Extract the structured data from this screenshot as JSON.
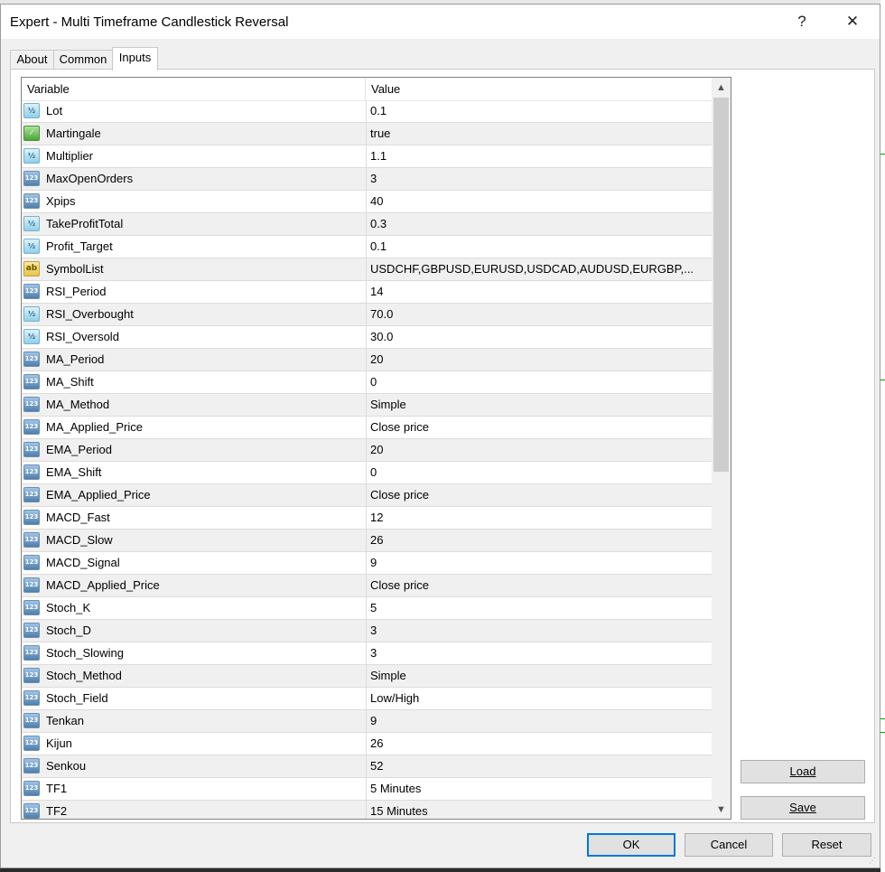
{
  "window": {
    "title": "Expert - Multi Timeframe Candlestick Reversal",
    "help_glyph": "?",
    "close_glyph": "✕"
  },
  "tabs": [
    {
      "label": "About",
      "active": false
    },
    {
      "label": "Common",
      "active": false
    },
    {
      "label": "Inputs",
      "active": true
    }
  ],
  "grid": {
    "header": {
      "variable": "Variable",
      "value": "Value"
    },
    "rows": [
      {
        "icon": "double-icon",
        "name": "Lot",
        "value": "0.1"
      },
      {
        "icon": "bool-icon",
        "name": "Martingale",
        "value": "true"
      },
      {
        "icon": "double-icon",
        "name": "Multiplier",
        "value": "1.1"
      },
      {
        "icon": "int-icon",
        "name": "MaxOpenOrders",
        "value": "3"
      },
      {
        "icon": "int-icon",
        "name": "Xpips",
        "value": "40"
      },
      {
        "icon": "double-icon",
        "name": "TakeProfitTotal",
        "value": "0.3"
      },
      {
        "icon": "double-icon",
        "name": "Profit_Target",
        "value": "0.1"
      },
      {
        "icon": "string-icon",
        "name": "SymbolList",
        "value": "USDCHF,GBPUSD,EURUSD,USDCAD,AUDUSD,EURGBP,..."
      },
      {
        "icon": "int-icon",
        "name": "RSI_Period",
        "value": "14"
      },
      {
        "icon": "double-icon",
        "name": "RSI_Overbought",
        "value": "70.0"
      },
      {
        "icon": "double-icon",
        "name": "RSI_Oversold",
        "value": "30.0"
      },
      {
        "icon": "int-icon",
        "name": "MA_Period",
        "value": "20"
      },
      {
        "icon": "int-icon",
        "name": "MA_Shift",
        "value": "0"
      },
      {
        "icon": "int-icon",
        "name": "MA_Method",
        "value": "Simple"
      },
      {
        "icon": "int-icon",
        "name": "MA_Applied_Price",
        "value": "Close price"
      },
      {
        "icon": "int-icon",
        "name": "EMA_Period",
        "value": "20"
      },
      {
        "icon": "int-icon",
        "name": "EMA_Shift",
        "value": "0"
      },
      {
        "icon": "int-icon",
        "name": "EMA_Applied_Price",
        "value": "Close price"
      },
      {
        "icon": "int-icon",
        "name": "MACD_Fast",
        "value": "12"
      },
      {
        "icon": "int-icon",
        "name": "MACD_Slow",
        "value": "26"
      },
      {
        "icon": "int-icon",
        "name": "MACD_Signal",
        "value": "9"
      },
      {
        "icon": "int-icon",
        "name": "MACD_Applied_Price",
        "value": "Close price"
      },
      {
        "icon": "int-icon",
        "name": "Stoch_K",
        "value": "5"
      },
      {
        "icon": "int-icon",
        "name": "Stoch_D",
        "value": "3"
      },
      {
        "icon": "int-icon",
        "name": "Stoch_Slowing",
        "value": "3"
      },
      {
        "icon": "int-icon",
        "name": "Stoch_Method",
        "value": "Simple"
      },
      {
        "icon": "int-icon",
        "name": "Stoch_Field",
        "value": "Low/High"
      },
      {
        "icon": "int-icon",
        "name": "Tenkan",
        "value": "9"
      },
      {
        "icon": "int-icon",
        "name": "Kijun",
        "value": "26"
      },
      {
        "icon": "int-icon",
        "name": "Senkou",
        "value": "52"
      },
      {
        "icon": "int-icon",
        "name": "TF1",
        "value": "5 Minutes"
      },
      {
        "icon": "int-icon",
        "name": "TF2",
        "value": "15 Minutes"
      }
    ]
  },
  "buttons": {
    "load": "Load",
    "save": "Save",
    "ok": "OK",
    "cancel": "Cancel",
    "reset": "Reset"
  },
  "colors": {
    "window_bg": "#f0f0f0",
    "primary_border": "#0078d7"
  }
}
